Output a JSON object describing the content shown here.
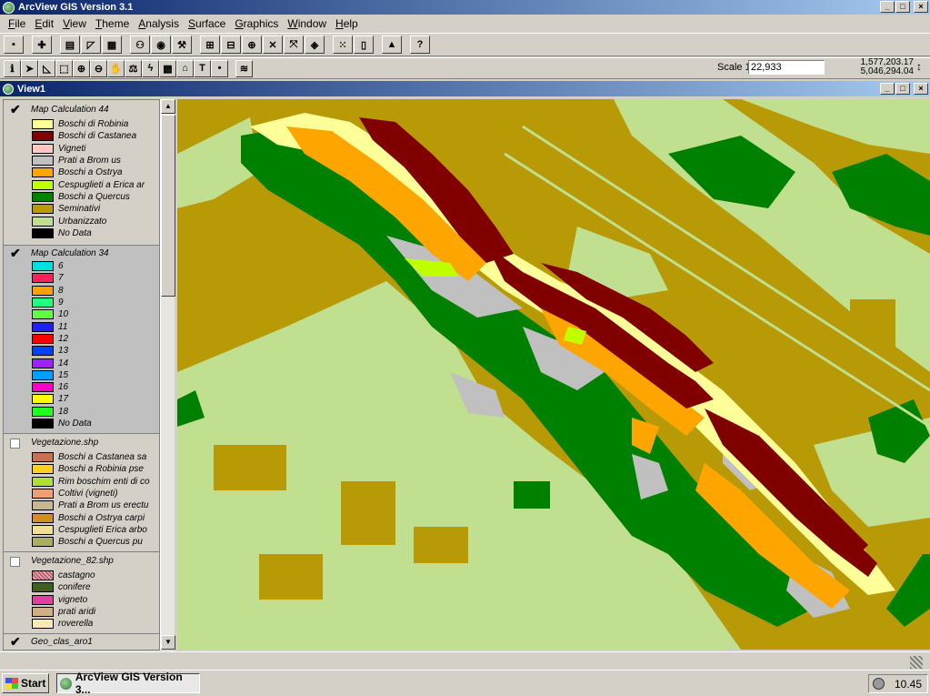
{
  "app": {
    "title": "ArcView GIS Version 3.1",
    "min": "_",
    "max": "□",
    "close": "×"
  },
  "menu": [
    "File",
    "Edit",
    "View",
    "Theme",
    "Analysis",
    "Surface",
    "Graphics",
    "Window",
    "Help"
  ],
  "toolbar": {
    "buttons": [
      "save-icon",
      "add-theme-icon",
      "theme-properties-icon",
      "edit-legend-icon",
      "open-table-icon",
      "query-builder-icon",
      "locate-icon",
      "hotlink-icon",
      "zoom-full-icon",
      "zoom-active-icon",
      "zoom-selected-icon",
      "zoom-in-icon",
      "zoom-out-icon",
      "zoom-previous-icon",
      "select-by-theme-icon",
      "clear-selected-icon",
      "histogram-icon",
      "help-icon"
    ],
    "tools": [
      "identify-icon",
      "pointer-icon",
      "vertex-edit-icon",
      "select-feature-icon",
      "zoom-in-tool-icon",
      "zoom-out-tool-icon",
      "pan-icon",
      "measure-icon",
      "hotlink-tool-icon",
      "area-of-interest-icon",
      "label-icon",
      "text-icon",
      "draw-point-icon",
      "surface-tool-icon"
    ],
    "text_tool_label": "T"
  },
  "scale": {
    "label": "Scale 1:",
    "value": "22,933"
  },
  "coords": {
    "x": "1,577,203.17",
    "y": "5,046,294.04"
  },
  "view": {
    "title": "View1"
  },
  "toc": {
    "themes": [
      {
        "name": "Map Calculation 44",
        "checked": true,
        "active": false,
        "classes": [
          {
            "label": "Boschi di Robinia",
            "color": "#ffff99"
          },
          {
            "label": "Boschi di Castanea",
            "color": "#800000"
          },
          {
            "label": "Vigneti",
            "color": "#ffc8c0"
          },
          {
            "label": "Prati a Brom us",
            "color": "#c0c0c0"
          },
          {
            "label": "Boschi a Ostrya",
            "color": "#ffa500"
          },
          {
            "label": "Cespuglieti a Erica ar",
            "color": "#c0ff00"
          },
          {
            "label": "Boschi a Quercus",
            "color": "#008000"
          },
          {
            "label": "Seminativi",
            "color": "#b89a06"
          },
          {
            "label": "Urbanizzato",
            "color": "#c0e090"
          },
          {
            "label": "No Data",
            "color": "#000000"
          }
        ]
      },
      {
        "name": "Map Calculation 34",
        "checked": true,
        "active": true,
        "classes": [
          {
            "label": "6",
            "color": "#00e0e0"
          },
          {
            "label": "7",
            "color": "#ff2060"
          },
          {
            "label": "8",
            "color": "#ffa000"
          },
          {
            "label": "9",
            "color": "#20ff80"
          },
          {
            "label": "10",
            "color": "#60ff40"
          },
          {
            "label": "11",
            "color": "#2020ff"
          },
          {
            "label": "12",
            "color": "#ff0000"
          },
          {
            "label": "13",
            "color": "#0040ff"
          },
          {
            "label": "14",
            "color": "#a020ff"
          },
          {
            "label": "15",
            "color": "#00a0ff"
          },
          {
            "label": "16",
            "color": "#ff00c0"
          },
          {
            "label": "17",
            "color": "#ffff00"
          },
          {
            "label": "18",
            "color": "#20ff20"
          },
          {
            "label": "No Data",
            "color": "#000000"
          }
        ]
      },
      {
        "name": "Vegetazione.shp",
        "checked": false,
        "active": false,
        "classes": [
          {
            "label": "Boschi a Castanea sa",
            "color": "#c87050"
          },
          {
            "label": "Boschi a Robinia pse",
            "color": "#ffd020"
          },
          {
            "label": "Rim boschim enti di co",
            "color": "#b0e030"
          },
          {
            "label": "Coltivi (vigneti)",
            "color": "#f0a070"
          },
          {
            "label": "Prati a Brom us erectu",
            "color": "#c8b890"
          },
          {
            "label": "Boschi a Ostrya carpi",
            "color": "#d09020"
          },
          {
            "label": "Cespuglieti Erica arbo",
            "color": "#f0e090"
          },
          {
            "label": "Boschi a Quercus pu",
            "color": "#a8b060"
          }
        ]
      },
      {
        "name": "Vegetazione_82.shp",
        "checked": false,
        "active": false,
        "classes": [
          {
            "label": "castagno",
            "color": "#c06070"
          },
          {
            "label": "conifere",
            "color": "#406020"
          },
          {
            "label": "vigneto",
            "color": "#e040a0"
          },
          {
            "label": "prati aridi",
            "color": "#d0b080"
          },
          {
            "label": "roverella",
            "color": "#fff0c0"
          }
        ]
      },
      {
        "name": "Geo_clas_aro1",
        "checked": true,
        "active": false,
        "classes": []
      }
    ]
  },
  "taskbar": {
    "start": "Start",
    "task": "ArcView GIS Version 3...",
    "time": "10.45"
  }
}
